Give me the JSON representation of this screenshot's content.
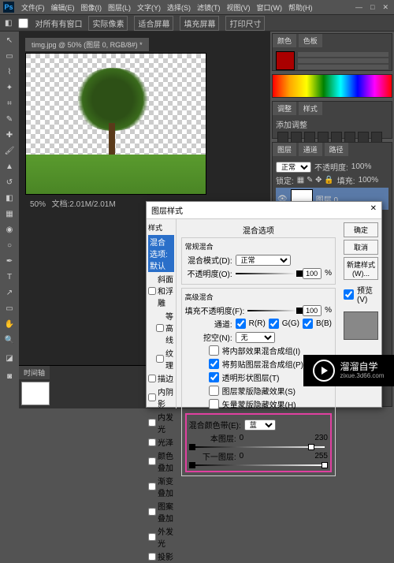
{
  "menubar": {
    "items": [
      "文件(F)",
      "编辑(E)",
      "图像(I)",
      "图层(L)",
      "文字(Y)",
      "选择(S)",
      "滤镜(T)",
      "视图(V)",
      "窗口(W)",
      "帮助(H)"
    ]
  },
  "optbar": {
    "items": [
      "对所有有窗口",
      "实际像素",
      "适合屏幕",
      "填充屏幕",
      "打印尺寸"
    ]
  },
  "document": {
    "tab": "timg.jpg @ 50% (图层 0, RGB/8#) *",
    "zoom": "50%",
    "info": "文档:2.01M/2.01M"
  },
  "panels": {
    "color": {
      "tab1": "颜色",
      "tab2": "色板"
    },
    "adjust": {
      "tab1": "调整",
      "tab2": "样式",
      "hint": "添加调整"
    },
    "layers": {
      "tab1": "图层",
      "tab2": "通道",
      "tab3": "路径",
      "mode": "正常",
      "opacity": "不透明度:",
      "opacity_val": "100%",
      "lock": "锁定:",
      "fill": "填充:",
      "fill_val": "100%",
      "layer_name": "图层 0"
    }
  },
  "timeline": {
    "tab": "时间轴"
  },
  "dialog": {
    "title": "图层样式",
    "styles_header": "样式",
    "styles": [
      {
        "label": "混合选项:默认",
        "sel": true
      },
      {
        "label": "斜面和浮雕",
        "checked": false
      },
      {
        "label": "等高线",
        "checked": false,
        "indent": true
      },
      {
        "label": "纹理",
        "checked": false,
        "indent": true
      },
      {
        "label": "描边",
        "checked": false
      },
      {
        "label": "内阴影",
        "checked": false
      },
      {
        "label": "内发光",
        "checked": false
      },
      {
        "label": "光泽",
        "checked": false
      },
      {
        "label": "颜色叠加",
        "checked": false
      },
      {
        "label": "渐变叠加",
        "checked": false
      },
      {
        "label": "图案叠加",
        "checked": false
      },
      {
        "label": "外发光",
        "checked": false
      },
      {
        "label": "投影",
        "checked": false
      }
    ],
    "blend": {
      "header": "混合选项",
      "general": "常规混合",
      "mode_label": "混合模式(D):",
      "mode_val": "正常",
      "opacity_label": "不透明度(O):",
      "opacity_val": "100",
      "pct": "%",
      "advanced": "高级混合",
      "fill_label": "填充不透明度(F):",
      "fill_val": "100",
      "channels_label": "通道:",
      "ch_r": "R(R)",
      "ch_g": "G(G)",
      "ch_b": "B(B)",
      "knockout_label": "挖空(N):",
      "knockout_val": "无",
      "opt1": "将内部效果混合成组(I)",
      "opt2": "将剪贴图层混合成组(P)",
      "opt3": "透明形状图层(T)",
      "opt4": "图层蒙版隐藏效果(S)",
      "opt5": "矢量蒙版隐藏效果(H)",
      "blendif_label": "混合颜色带(E):",
      "blendif_val": "蓝",
      "this_layer": "本图层:",
      "this_lo": "0",
      "this_hi": "230",
      "under_layer": "下一图层:",
      "under_lo": "0",
      "under_hi": "255"
    },
    "buttons": {
      "ok": "确定",
      "cancel": "取消",
      "new": "新建样式(W)...",
      "preview": "预览(V)"
    }
  },
  "watermark": {
    "text": "溜溜自学",
    "sub": "zixue.3d66.com"
  }
}
